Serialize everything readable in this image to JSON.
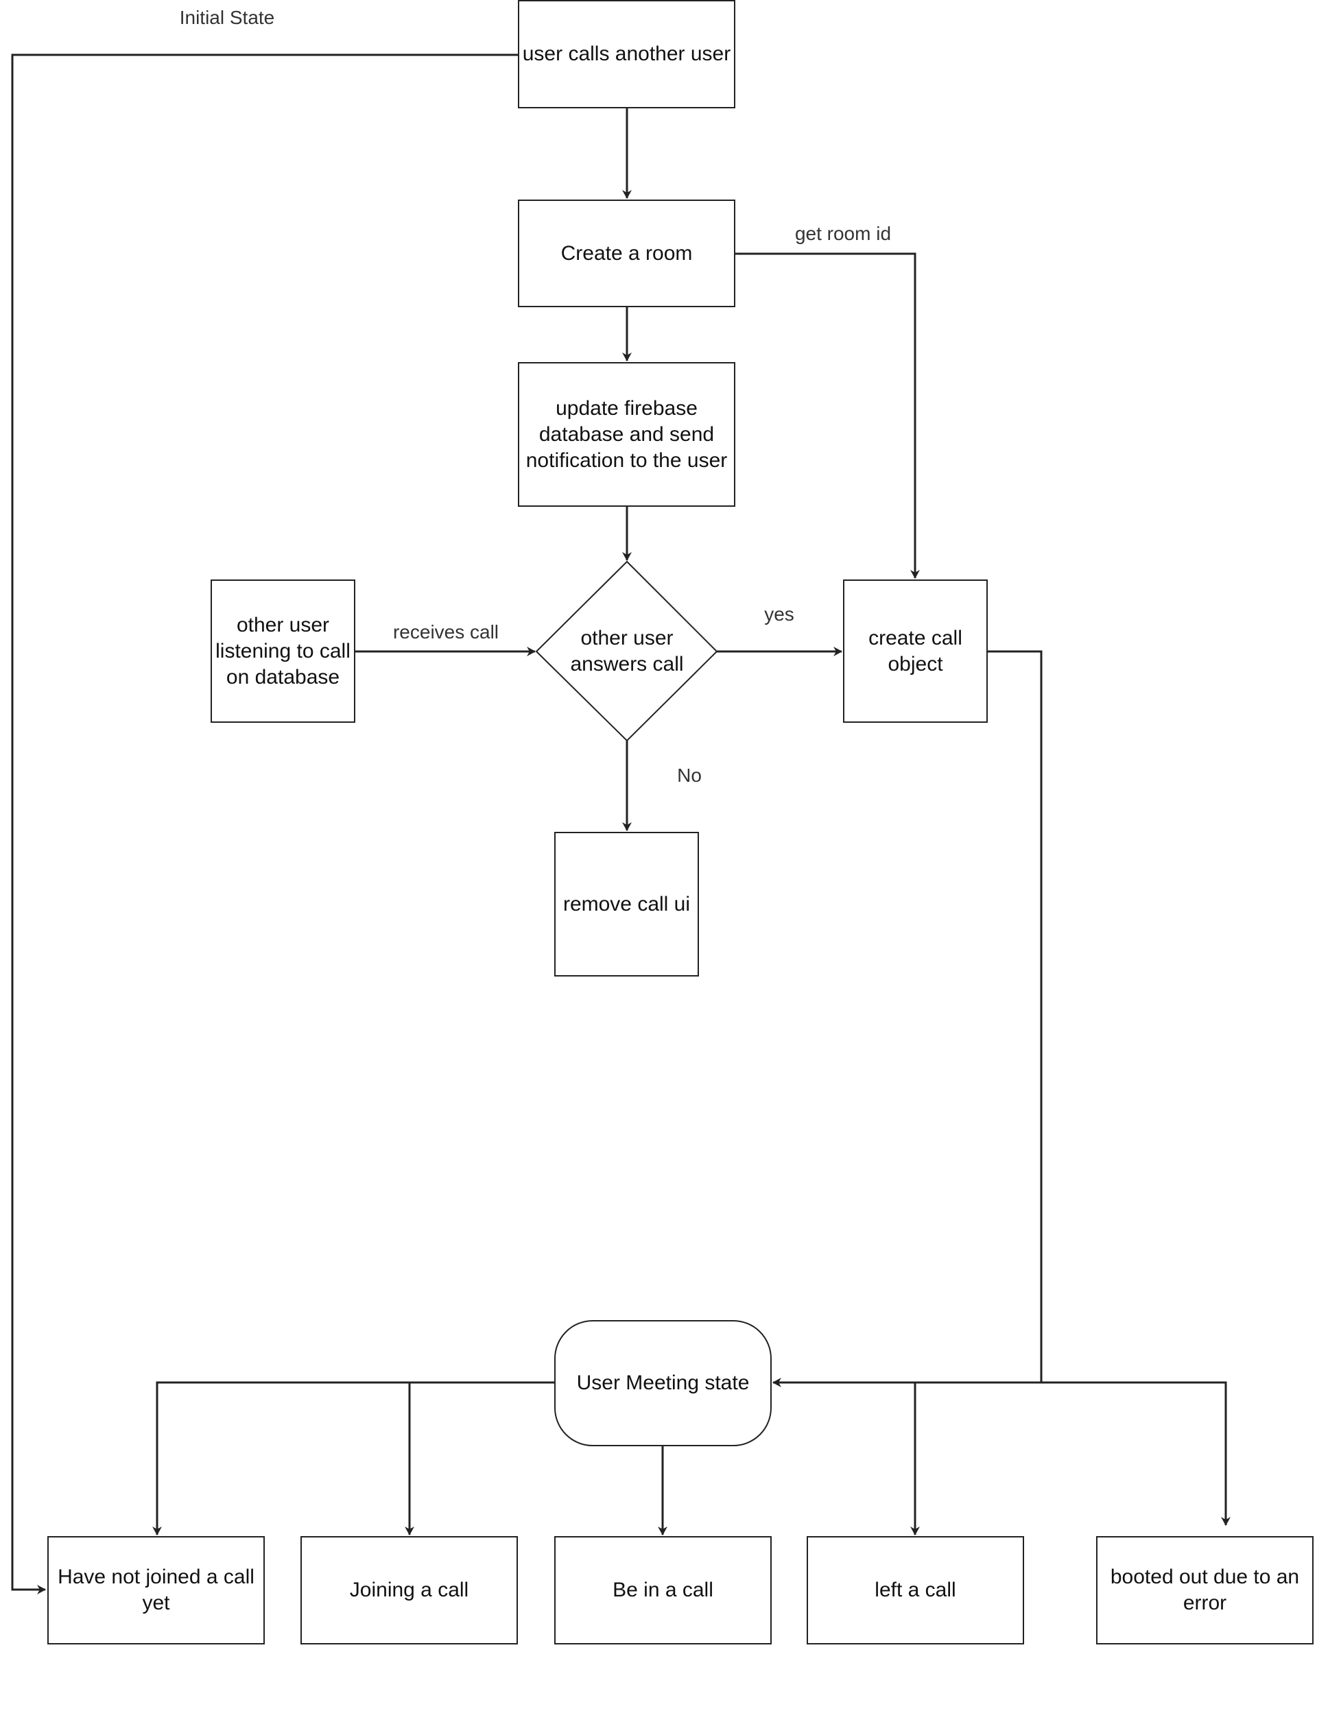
{
  "diagram": {
    "nodes": {
      "user_calls": "user calls another user",
      "create_room": "Create a room",
      "update_firebase": "update firebase database and send notification to the user",
      "other_user_listening": "other user listening to call on database",
      "decision_answers": "other user answers call",
      "create_call_object": "create call object",
      "remove_call_ui": "remove call ui",
      "meeting_state": "User Meeting state",
      "state_not_joined": "Have not joined a call yet",
      "state_joining": "Joining a call",
      "state_in_call": "Be in a call",
      "state_left": "left a call",
      "state_booted": "booted out due to an error"
    },
    "edge_labels": {
      "initial_state": "Initial State",
      "get_room_id": "get room id",
      "receives_call": "receives call",
      "yes": "yes",
      "no": "No"
    },
    "colors": {
      "stroke": "#222222",
      "background": "#ffffff",
      "label": "#333333"
    }
  }
}
